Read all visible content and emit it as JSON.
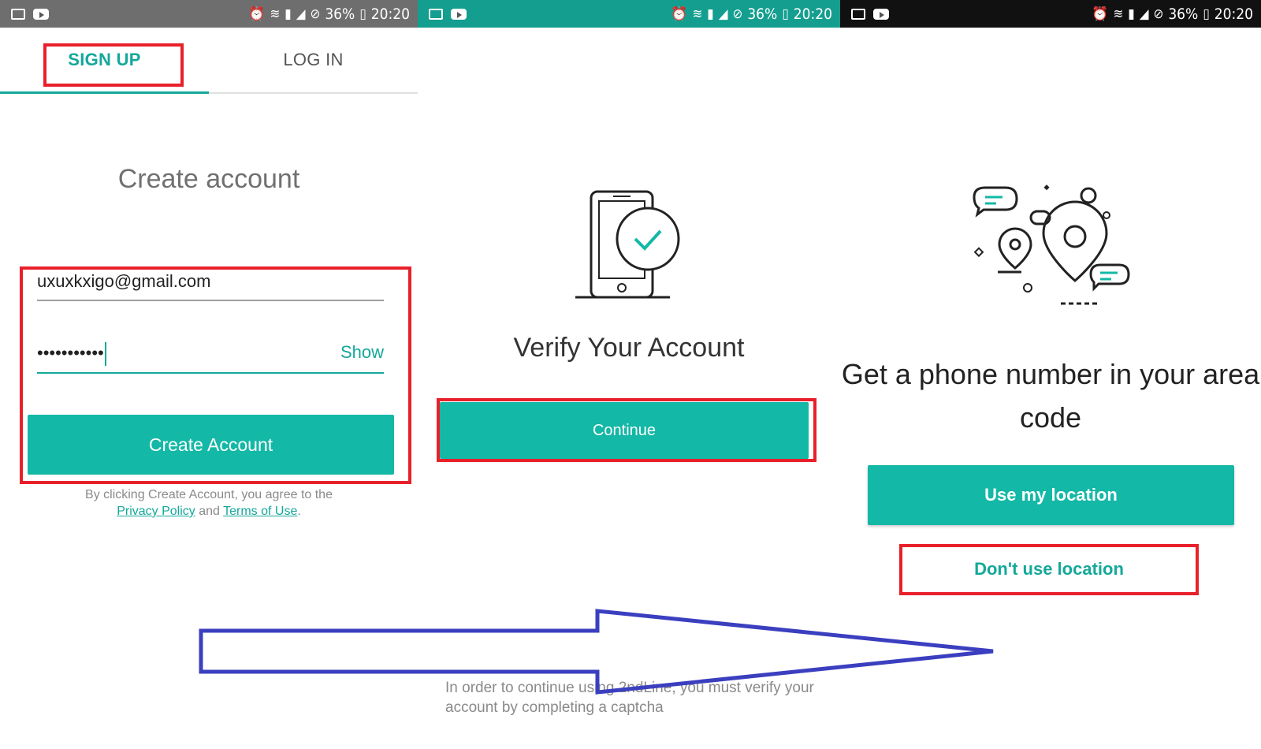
{
  "status_bar": {
    "battery": "36%",
    "time": "20:20",
    "left_icons": [
      "gallery-icon",
      "youtube-icon"
    ],
    "right_icons": [
      "alarm-icon",
      "wifi-icon",
      "sim-icon",
      "signal-icon",
      "dnd-icon",
      "battery-icon"
    ],
    "colors": [
      "#6e6e6e",
      "#139e8f",
      "#111111"
    ]
  },
  "signup_screen": {
    "tabs": [
      {
        "label": "SIGN UP",
        "active": true
      },
      {
        "label": "LOG IN",
        "active": false
      }
    ],
    "title": "Create account",
    "email_value": "uxuxkxigo@gmail.com",
    "password_masked": "•••••••••••",
    "show_label": "Show",
    "create_button_label": "Create Account",
    "legal_prefix": "By clicking Create Account, you agree to the",
    "privacy_link": "Privacy Policy",
    "legal_and": "and",
    "terms_link": "Terms of Use",
    "legal_suffix": "."
  },
  "verify_screen": {
    "title": "Verify Your Account",
    "continue_label": "Continue",
    "captcha_note": "In order to continue using 2ndLine, you must verify your account by completing a captcha",
    "illustration": "phone-check-icon"
  },
  "location_screen": {
    "title": "Get a phone number in your area code",
    "use_location_label": "Use my location",
    "dont_use_location_label": "Don't use location",
    "illustration": "location-chat-icon"
  },
  "colors": {
    "accent": "#14b8a6",
    "highlight": "#e8202a",
    "arrow": "#3b3fbf"
  }
}
